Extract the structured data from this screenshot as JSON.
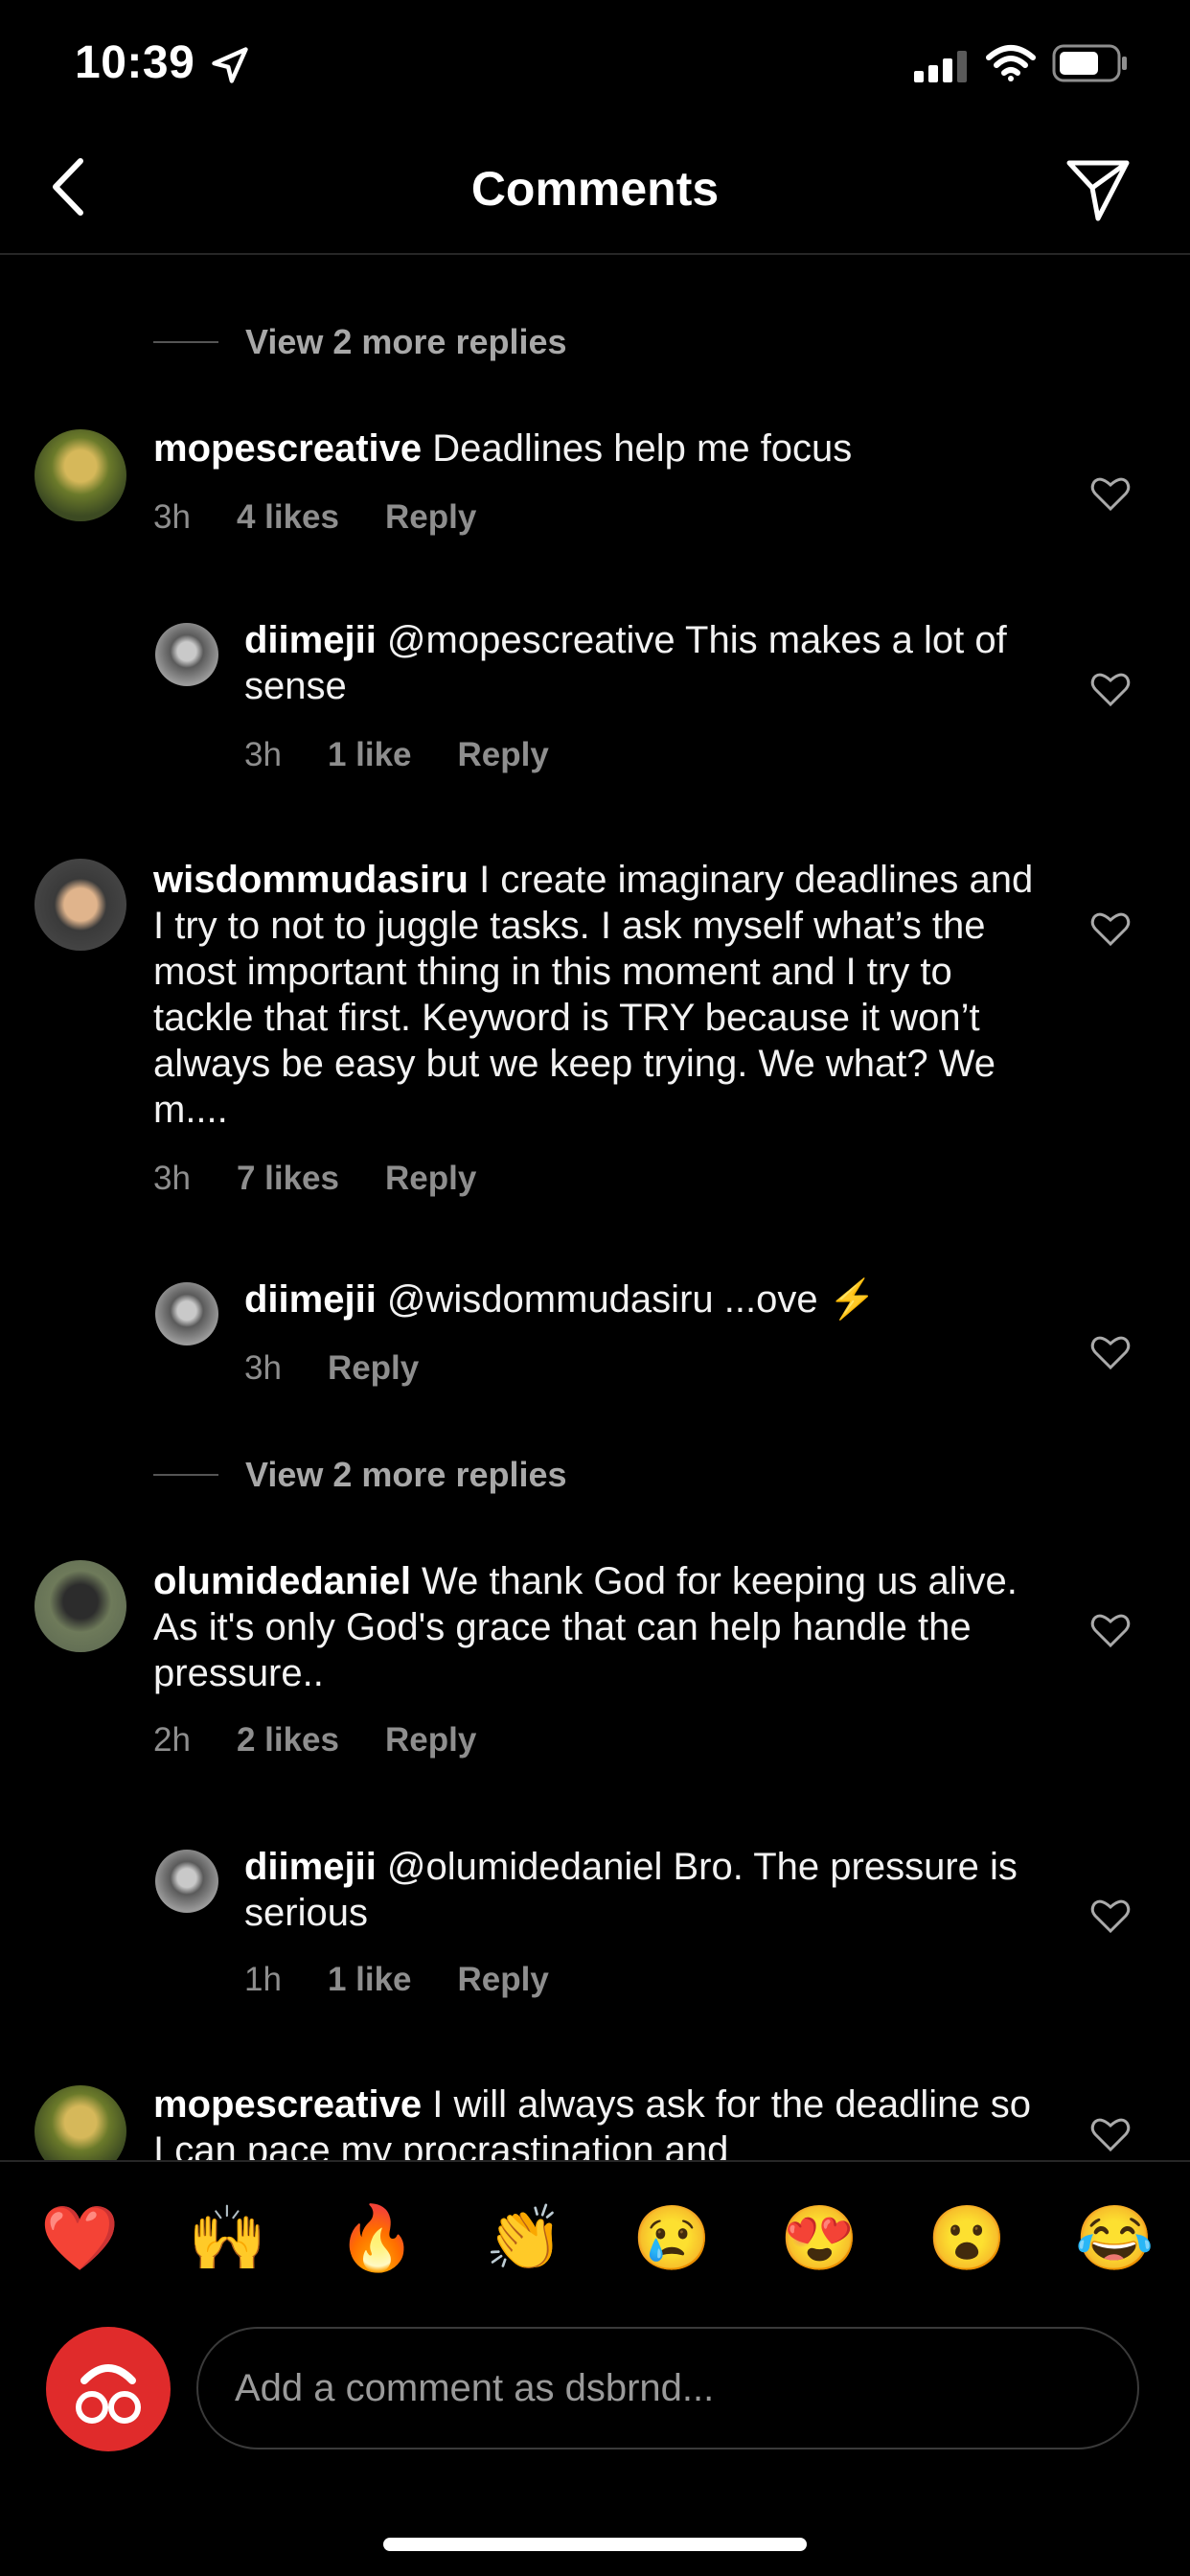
{
  "status": {
    "time": "10:39"
  },
  "header": {
    "title": "Comments"
  },
  "comments_list": {
    "view_more_1": "View 2 more replies",
    "c1": {
      "user": "mopescreative",
      "text": " Deadlines help me focus",
      "time": "3h",
      "likes": "4 likes",
      "reply": "Reply"
    },
    "r1": {
      "user": "diimejii",
      "text": " @mopescreative This makes a lot of sense",
      "time": "3h",
      "likes": "1 like",
      "reply": "Reply"
    },
    "c2": {
      "user": "wisdommudasiru",
      "text": " I create imaginary deadlines and I try to not to juggle tasks. I ask myself what’s the most important thing in this moment and I try to tackle that first. Keyword is TRY because it won’t always be easy but we keep trying. We what? We m....",
      "time": "3h",
      "likes": "7 likes",
      "reply": "Reply"
    },
    "r2": {
      "user": "diimejii",
      "text": " @wisdommudasiru ...ove ⚡",
      "time": "3h",
      "reply": "Reply"
    },
    "view_more_2": "View 2 more replies",
    "c3": {
      "user": "olumidedaniel",
      "text": " We thank God for keeping us alive. As it's only God's grace that can help handle the pressure..",
      "time": "2h",
      "likes": "2 likes",
      "reply": "Reply"
    },
    "r3": {
      "user": "diimejii",
      "text": " @olumidedaniel Bro. The pressure is serious",
      "time": "1h",
      "likes": "1 like",
      "reply": "Reply"
    },
    "c4": {
      "user": "mopescreative",
      "text": " I will always ask for the deadline so I can pace my procrastination and"
    }
  },
  "emoji_bar": [
    "❤️",
    "🙌",
    "🔥",
    "👏",
    "😢",
    "😍",
    "😮",
    "😂"
  ],
  "input": {
    "placeholder": "Add a comment as dsbrnd..."
  },
  "colors": {
    "background": "#000000",
    "secondary_text": "#8e8e8e",
    "avatar_accent": "#e02b2b"
  }
}
